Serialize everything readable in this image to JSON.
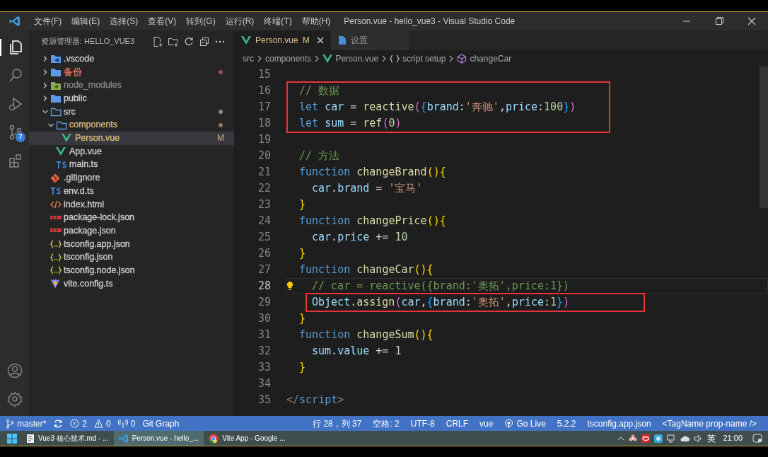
{
  "title_bar": {
    "menus": [
      "文件(F)",
      "编辑(E)",
      "选择(S)",
      "查看(V)",
      "转到(G)",
      "运行(R)",
      "终端(T)",
      "帮助(H)"
    ],
    "title": "Person.vue - hello_vue3 - Visual Studio Code"
  },
  "activity_bar": {
    "items": [
      {
        "kind": "files",
        "selected": true
      },
      {
        "kind": "search",
        "selected": false
      },
      {
        "kind": "debug",
        "selected": false
      },
      {
        "kind": "git",
        "selected": false,
        "badge": "7"
      },
      {
        "kind": "extensions",
        "selected": false
      }
    ],
    "bottom": [
      {
        "kind": "account"
      },
      {
        "kind": "settings"
      }
    ]
  },
  "sidebar": {
    "title": "资源管理器: HELLO_VUE3",
    "items": [
      {
        "label": ".vscode",
        "kind": "folder-vscode",
        "expanded": false,
        "color": "#cccccc",
        "selected": false
      },
      {
        "label": "备份",
        "kind": "folder",
        "expanded": false,
        "color": "#e2725b",
        "dot": true,
        "selected": false
      },
      {
        "label": "node_modules",
        "kind": "folder-node",
        "expanded": false,
        "color": "#858585",
        "selected": false
      },
      {
        "label": "public",
        "kind": "folder",
        "expanded": false,
        "color": "#cccccc",
        "selected": false
      },
      {
        "label": "src",
        "kind": "folder-open",
        "expanded": true,
        "color": "#cccccc",
        "dot": true,
        "selected": false,
        "children": [
          {
            "label": "components",
            "kind": "folder-open",
            "expanded": true,
            "color": "#d7ba7d",
            "dot": true,
            "selected": false,
            "children": [
              {
                "label": "Person.vue",
                "kind": "vue",
                "color": "#d7ba7d",
                "badge": "M",
                "selected": true
              }
            ]
          },
          {
            "label": "App.vue",
            "kind": "vue",
            "color": "#cccccc",
            "selected": false
          },
          {
            "label": "main.ts",
            "kind": "ts",
            "color": "#cccccc",
            "selected": false
          }
        ]
      },
      {
        "label": ".gitignore",
        "kind": "git",
        "color": "#cccccc",
        "selected": false
      },
      {
        "label": "env.d.ts",
        "kind": "ts",
        "color": "#cccccc",
        "selected": false
      },
      {
        "label": "index.html",
        "kind": "html",
        "color": "#cccccc",
        "selected": false
      },
      {
        "label": "package-lock.json",
        "kind": "npm",
        "color": "#cccccc",
        "selected": false
      },
      {
        "label": "package.json",
        "kind": "npm",
        "color": "#cccccc",
        "selected": false
      },
      {
        "label": "tsconfig.app.json",
        "kind": "json",
        "color": "#cccccc",
        "selected": false
      },
      {
        "label": "tsconfig.json",
        "kind": "json",
        "color": "#cccccc",
        "selected": false
      },
      {
        "label": "tsconfig.node.json",
        "kind": "json",
        "color": "#cccccc",
        "selected": false
      },
      {
        "label": "vite.config.ts",
        "kind": "vite",
        "color": "#cccccc",
        "selected": false
      }
    ]
  },
  "tabs": [
    {
      "label": "Person.vue",
      "kind": "vue",
      "badge": "M",
      "selected": true
    },
    {
      "label": "设置",
      "kind": "file",
      "selected": false
    }
  ],
  "breadcrumb": [
    {
      "label": "src",
      "kind": "plain"
    },
    {
      "label": "components",
      "kind": "plain"
    },
    {
      "label": "Person.vue",
      "kind": "vue"
    },
    {
      "label": "script setup",
      "kind": "braces"
    },
    {
      "label": "changeCar",
      "kind": "cube"
    }
  ],
  "code": [
    {
      "number": "15",
      "kind": "body",
      "current": false,
      "boxed": false
    },
    {
      "number": "16",
      "kind": "body",
      "current": false,
      "boxed": true,
      "tokens": [
        {
          "kind": "comment",
          "text": "// 数据"
        }
      ]
    },
    {
      "number": "17",
      "kind": "body",
      "current": false,
      "boxed": true,
      "tokens": [
        {
          "kind": "keyword",
          "text": "let "
        },
        {
          "kind": "var",
          "text": "car"
        },
        {
          "kind": "plain",
          "text": " = "
        },
        {
          "kind": "func",
          "text": "reactive"
        },
        {
          "kind": "paren",
          "text": "("
        },
        {
          "kind": "brace",
          "text": "{"
        },
        {
          "kind": "var",
          "text": "brand"
        },
        {
          "kind": "plain",
          "text": ":"
        },
        {
          "kind": "string",
          "text": "'奔驰'"
        },
        {
          "kind": "plain",
          "text": ","
        },
        {
          "kind": "var",
          "text": "price"
        },
        {
          "kind": "plain",
          "text": ":"
        },
        {
          "kind": "number",
          "text": "100"
        },
        {
          "kind": "brace",
          "text": "}"
        },
        {
          "kind": "paren",
          "text": ")"
        }
      ]
    },
    {
      "number": "18",
      "kind": "body",
      "current": false,
      "boxed": true,
      "tokens": [
        {
          "kind": "keyword",
          "text": "let "
        },
        {
          "kind": "var",
          "text": "sum"
        },
        {
          "kind": "plain",
          "text": " = "
        },
        {
          "kind": "func",
          "text": "ref"
        },
        {
          "kind": "paren",
          "text": "("
        },
        {
          "kind": "number",
          "text": "0"
        },
        {
          "kind": "paren",
          "text": ")"
        }
      ]
    },
    {
      "number": "19",
      "kind": "body",
      "current": false,
      "boxed": false
    },
    {
      "number": "20",
      "kind": "body",
      "current": false,
      "boxed": false,
      "tokens": [
        {
          "kind": "comment",
          "text": "// 方法"
        }
      ]
    },
    {
      "number": "21",
      "kind": "body",
      "current": false,
      "boxed": false,
      "tokens": [
        {
          "kind": "keyword",
          "text": "function "
        },
        {
          "kind": "func",
          "text": "changeBrand"
        },
        {
          "kind": "bracket",
          "text": "(){"
        }
      ]
    },
    {
      "number": "22",
      "kind": "nested",
      "current": false,
      "boxed": false,
      "tokens": [
        {
          "kind": "var",
          "text": "car"
        },
        {
          "kind": "plain",
          "text": "."
        },
        {
          "kind": "var",
          "text": "brand"
        },
        {
          "kind": "plain",
          "text": " = "
        },
        {
          "kind": "string",
          "text": "'宝马'"
        }
      ]
    },
    {
      "number": "23",
      "kind": "body",
      "current": false,
      "boxed": false,
      "tokens": [
        {
          "kind": "bracket",
          "text": "}"
        }
      ]
    },
    {
      "number": "24",
      "kind": "body",
      "current": false,
      "boxed": false,
      "tokens": [
        {
          "kind": "keyword",
          "text": "function "
        },
        {
          "kind": "func",
          "text": "changePrice"
        },
        {
          "kind": "bracket",
          "text": "(){"
        }
      ]
    },
    {
      "number": "25",
      "kind": "nested",
      "current": false,
      "boxed": false,
      "tokens": [
        {
          "kind": "var",
          "text": "car"
        },
        {
          "kind": "plain",
          "text": "."
        },
        {
          "kind": "var",
          "text": "price"
        },
        {
          "kind": "plain",
          "text": " += "
        },
        {
          "kind": "number",
          "text": "10"
        }
      ]
    },
    {
      "number": "26",
      "kind": "body",
      "current": false,
      "boxed": false,
      "tokens": [
        {
          "kind": "bracket",
          "text": "}"
        }
      ]
    },
    {
      "number": "27",
      "kind": "body",
      "current": false,
      "boxed": false,
      "tokens": [
        {
          "kind": "keyword",
          "text": "function "
        },
        {
          "kind": "func",
          "text": "changeCar"
        },
        {
          "kind": "bracket",
          "text": "(){"
        }
      ]
    },
    {
      "number": "28",
      "kind": "nested",
      "current": true,
      "lightbulb": true,
      "boxed": false,
      "tokens": [
        {
          "kind": "comment",
          "text": "// car = reactive({brand:'奥拓',price:1})"
        }
      ]
    },
    {
      "number": "29",
      "kind": "nested",
      "current": false,
      "boxed": true,
      "tokens": [
        {
          "kind": "var",
          "text": "Object"
        },
        {
          "kind": "plain",
          "text": "."
        },
        {
          "kind": "func",
          "text": "assign"
        },
        {
          "kind": "paren",
          "text": "("
        },
        {
          "kind": "var",
          "text": "car"
        },
        {
          "kind": "plain",
          "text": ","
        },
        {
          "kind": "brace",
          "text": "{"
        },
        {
          "kind": "var",
          "text": "brand"
        },
        {
          "kind": "plain",
          "text": ":"
        },
        {
          "kind": "string",
          "text": "'奥拓'"
        },
        {
          "kind": "plain",
          "text": ","
        },
        {
          "kind": "var",
          "text": "price"
        },
        {
          "kind": "plain",
          "text": ":"
        },
        {
          "kind": "number",
          "text": "1"
        },
        {
          "kind": "brace",
          "text": "}"
        },
        {
          "kind": "paren",
          "text": ")"
        }
      ]
    },
    {
      "number": "30",
      "kind": "body",
      "current": false,
      "boxed": false,
      "tokens": [
        {
          "kind": "bracket",
          "text": "}"
        }
      ]
    },
    {
      "number": "31",
      "kind": "body",
      "current": false,
      "boxed": false,
      "tokens": [
        {
          "kind": "keyword",
          "text": "function "
        },
        {
          "kind": "func",
          "text": "changeSum"
        },
        {
          "kind": "bracket",
          "text": "(){"
        }
      ]
    },
    {
      "number": "32",
      "kind": "nested",
      "current": false,
      "boxed": false,
      "tokens": [
        {
          "kind": "var",
          "text": "sum"
        },
        {
          "kind": "plain",
          "text": "."
        },
        {
          "kind": "var",
          "text": "value"
        },
        {
          "kind": "plain",
          "text": " += "
        },
        {
          "kind": "number",
          "text": "1"
        }
      ]
    },
    {
      "number": "33",
      "kind": "body",
      "current": false,
      "boxed": false,
      "tokens": [
        {
          "kind": "bracket",
          "text": "}"
        }
      ]
    },
    {
      "number": "34",
      "kind": "body",
      "current": false,
      "boxed": false
    },
    {
      "number": "35",
      "kind": "top",
      "current": false,
      "boxed": false,
      "tokens": [
        {
          "kind": "tagpunct",
          "text": "</"
        },
        {
          "kind": "keyword",
          "text": "script"
        },
        {
          "kind": "tagpunct",
          "text": ">"
        }
      ]
    }
  ],
  "status_bar": {
    "left": [
      {
        "kind": "branch",
        "text": "master*"
      },
      {
        "kind": "sync"
      },
      {
        "kind": "error",
        "text": "2"
      },
      {
        "kind": "warning",
        "text": "0"
      },
      {
        "kind": "antenna",
        "text": "0"
      },
      {
        "kind": "plain",
        "text": "Git Graph"
      }
    ],
    "right": [
      {
        "kind": "plain",
        "text": "行 28，列 37"
      },
      {
        "kind": "plain",
        "text": "空格: 2"
      },
      {
        "kind": "plain",
        "text": "UTF-8"
      },
      {
        "kind": "plain",
        "text": "CRLF"
      },
      {
        "kind": "plain",
        "text": "vue"
      },
      {
        "kind": "broadcast",
        "text": "Go Live"
      },
      {
        "kind": "plain",
        "text": "5.2.2"
      },
      {
        "kind": "plain",
        "text": "tsconfig.app.json"
      },
      {
        "kind": "plain",
        "text": "<TagName prop-name />"
      }
    ]
  },
  "taskbar": {
    "apps": [
      {
        "kind": "doc",
        "label": "Vue3 核心技术.md - ...",
        "selected": false
      },
      {
        "kind": "vscode",
        "label": "Person.vue - hello_...",
        "selected": true
      },
      {
        "kind": "chrome",
        "label": "Vite App - Google ...",
        "selected": false
      }
    ],
    "input_method": "英",
    "time": "21:00"
  }
}
